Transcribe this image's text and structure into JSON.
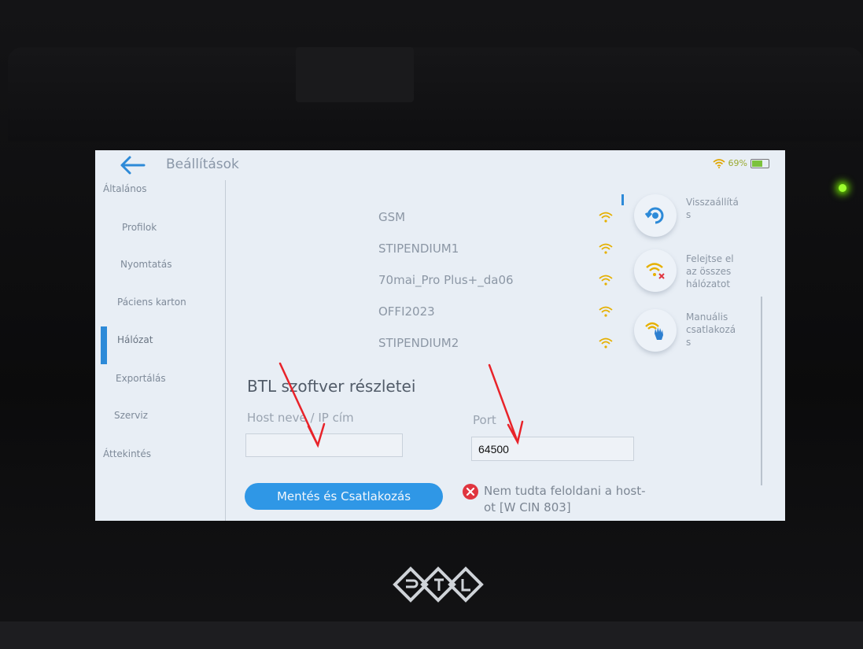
{
  "header": {
    "title": "Beállítások",
    "battery": "69%"
  },
  "sidebar": {
    "items": [
      {
        "label": "Általános"
      },
      {
        "label": "Profilok"
      },
      {
        "label": "Nyomtatás"
      },
      {
        "label": "Páciens karton"
      },
      {
        "label": "Hálózat"
      },
      {
        "label": "Exportálás"
      },
      {
        "label": "Szerviz"
      },
      {
        "label": "Áttekintés"
      }
    ],
    "active": "Hálózat"
  },
  "networks": [
    {
      "name": "GSM"
    },
    {
      "name": "STIPENDIUM1"
    },
    {
      "name": "70mai_Pro Plus+_da06"
    },
    {
      "name": "OFFI2023"
    },
    {
      "name": "STIPENDIUM2"
    }
  ],
  "actions": {
    "reset": {
      "line1": "Visszaállítá",
      "line2": "s"
    },
    "forget": {
      "line1": "Felejtse el",
      "line2": "az összes",
      "line3": "hálózatot"
    },
    "manual": {
      "line1": "Manuális",
      "line2": "csatlakozá",
      "line3": "s"
    }
  },
  "details": {
    "title": "BTL szoftver részletei",
    "host_label": "Host neve / IP cím",
    "host_value": "",
    "port_label": "Port",
    "port_value": "64500"
  },
  "save_button": "Mentés és Csatlakozás",
  "error": {
    "line1": "Nem tudta feloldani a host-",
    "line2": "ot [W CIN 803]"
  },
  "colors": {
    "accent": "#2f97e6",
    "error": "#e0353f",
    "led": "#9cff2e",
    "annotation_arrow": "#e8232a"
  }
}
